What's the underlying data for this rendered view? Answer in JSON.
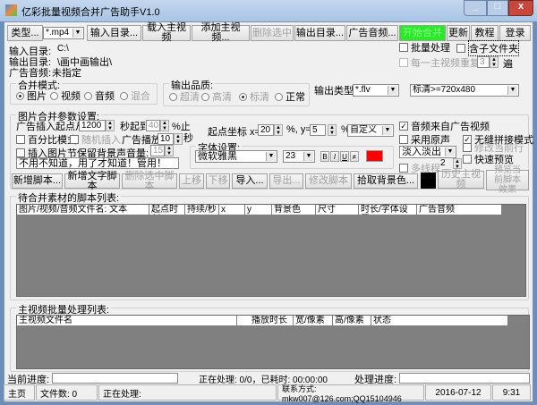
{
  "window": {
    "title": "亿彩批量视频合并广告助手V1.0"
  },
  "toolbar": {
    "type_btn": "类型...",
    "type_value": "*.mp4",
    "input_dir": "输入目录...",
    "load_main": "载入主视频",
    "add_main": "添加主视频...",
    "delete_selected": "删除选中",
    "output_dir": "输出目录...",
    "ad_audio": "广告音频...",
    "start_merge": "开始合并",
    "update": "更新",
    "tutorial": "教程",
    "login": "登录",
    "start_color": "#22ee22"
  },
  "info": {
    "input_label": "输入目录:",
    "input_value": "C:\\",
    "output_label": "输出目录:",
    "output_value": "\\画中画输出\\",
    "audio_label": "广告音频:",
    "audio_value": "未指定"
  },
  "options": {
    "batch": "批量处理",
    "subfolders": "含子文件夹",
    "repeat": "每一主视频重复做",
    "repeat_value": "3",
    "repeat_unit": "遍"
  },
  "merge_mode": {
    "title": "合并模式:",
    "items": [
      "图片",
      "视频",
      "音频",
      "混合"
    ],
    "selected": "图片"
  },
  "quality": {
    "title": "输出品质:",
    "items": [
      "超清",
      "高清",
      "标清",
      "正常"
    ],
    "selected": "标清"
  },
  "output_type": {
    "label": "输出类型:",
    "format": "*.flv",
    "resolution": "标清>=720x480"
  },
  "params": {
    "title": "图片合并参数设置:",
    "start_label": "广告插入起点从第",
    "start_value": "1200",
    "to_label": "秒起到",
    "to_value": "40",
    "pct_end": "%止",
    "coord_label": "起点坐标 x=",
    "x_value": "20",
    "pct_y": "%, y=",
    "y_value": "5",
    "pct": "%",
    "position": "自定义",
    "percent_mode": "百分比模式",
    "random_insert": "随机插入",
    "play_label": "广告播放:",
    "play_value": "10",
    "sec": "秒",
    "keep_bg": "插入图片节保留背景声",
    "volume_label": "音量:",
    "volume_value": "15",
    "text_value": "不用不知道，用了才知道！管用！",
    "audio_from_ad": "音频来自广告视频",
    "use_original": "采用原声",
    "seamless": "无缝拼接模式",
    "modify_row": "修改当前行",
    "quick_preview": "快速预览",
    "effect": "淡入淡出",
    "multithread": "多线程",
    "threads": "2"
  },
  "font": {
    "title": "字体设置:",
    "family": "微软雅黑",
    "size": "23",
    "bold": "B",
    "italic": "I",
    "underline": "U",
    "strike": "≠",
    "color": "#ff0000"
  },
  "script_buttons": {
    "add": "新增脚本...",
    "add_text": "新增文字脚本",
    "delete": "删除选中脚本",
    "up": "上移",
    "down": "下移",
    "import": "导入...",
    "export": "导出...",
    "modify": "修改脚本",
    "pick_bg": "拾取背景色...",
    "bg_color": "#000000",
    "history": "历史主视频",
    "preview": "预览当前脚本效果"
  },
  "script_list": {
    "title": "待合并素材的脚本列表:",
    "columns": [
      "图片/视频/音频文件名: 文本",
      "起点时刻",
      "持续/秒",
      "x",
      "y",
      "背景色",
      "尺寸",
      "时长/字体设置",
      "广告音频"
    ]
  },
  "batch_list": {
    "title": "主视频批量处理列表:",
    "columns": [
      "主视频文件名",
      "播放时长",
      "宽/像素",
      "高/像素",
      "状态"
    ]
  },
  "progress": {
    "current_label": "当前进度:",
    "processing": "正在处理: 0/0，已耗时: 00:00:00",
    "process_label": "处理进度:"
  },
  "status": {
    "home": "主页",
    "files": "文件数: 0",
    "processing": "正在处理:",
    "contact": "联系方式: mkw007@126.com;QQ15104946",
    "date": "2016-07-12",
    "time": "9:31"
  }
}
